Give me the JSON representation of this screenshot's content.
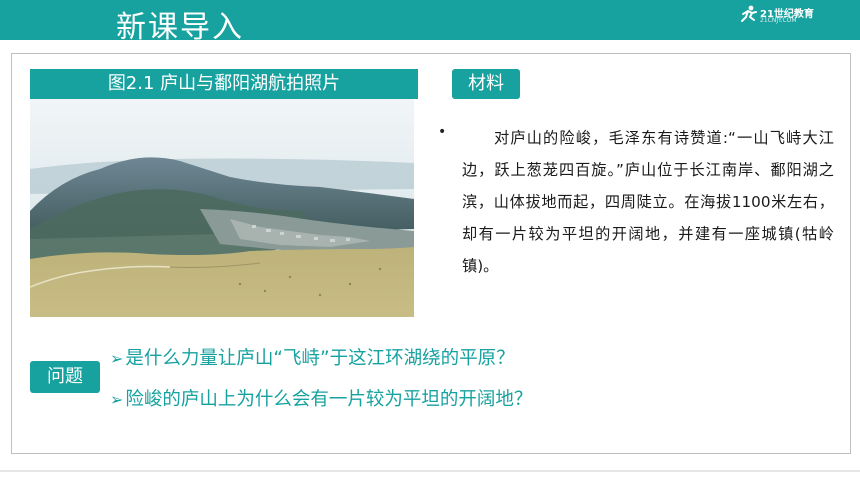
{
  "header": {
    "title": "新课导入",
    "logo_text": "21世纪教育",
    "logo_subtext": "21CNJY.COM"
  },
  "figure": {
    "caption": "图2.1 庐山与鄱阳湖航拍照片"
  },
  "material": {
    "tag": "材料",
    "bullet": "•",
    "text": "对庐山的险峻，毛泽东有诗赞道:“一山飞峙大江边，跃上葱茏四百旋。”庐山位于长江南岸、鄱阳湖之滨，山体拔地而起，四周陡立。在海拔1100米左右，却有一片较为平坦的开阔地，并建有一座城镇(牯岭镇)。"
  },
  "questions": {
    "tag": "问题",
    "arrow": "➢",
    "items": [
      "是什么力量让庐山“飞峙”于这江环湖绕的平原？",
      "险峻的庐山上为什么会有一片较为平坦的开阔地？"
    ]
  },
  "colors": {
    "accent": "#17a2a0"
  }
}
